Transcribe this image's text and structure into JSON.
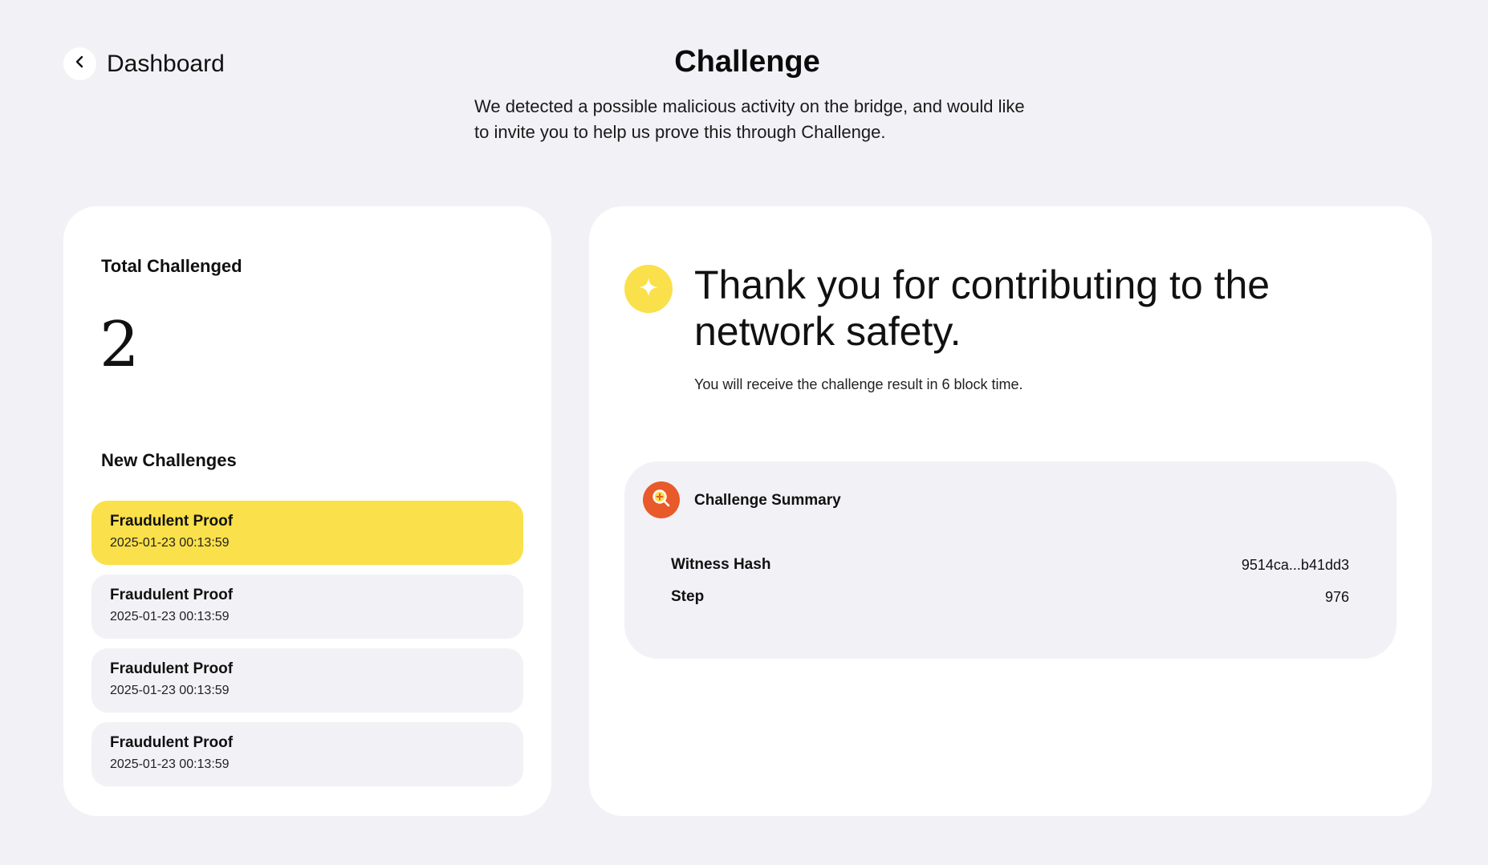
{
  "header": {
    "back_label": "Dashboard",
    "title": "Challenge",
    "subtitle": "We detected a possible malicious activity on the bridge, and would like to invite you to help us prove this through Challenge."
  },
  "left_panel": {
    "total_label": "Total Challenged",
    "total_value": "2",
    "new_label": "New Challenges",
    "challenges": [
      {
        "title": "Fraudulent Proof",
        "time": "2025-01-23 00:13:59",
        "selected": true
      },
      {
        "title": "Fraudulent Proof",
        "time": "2025-01-23 00:13:59",
        "selected": false
      },
      {
        "title": "Fraudulent Proof",
        "time": "2025-01-23 00:13:59",
        "selected": false
      },
      {
        "title": "Fraudulent Proof",
        "time": "2025-01-23 00:13:59",
        "selected": false
      }
    ]
  },
  "right_panel": {
    "icon": "sparkle-icon",
    "heading": "Thank you for contributing to the network safety.",
    "note": "You will receive the challenge result in 6 block time.",
    "summary": {
      "icon": "search-icon",
      "title": "Challenge Summary",
      "rows": [
        {
          "key": "Witness Hash",
          "value": "9514ca...b41dd3"
        },
        {
          "key": "Step",
          "value": "976"
        }
      ]
    }
  },
  "colors": {
    "background": "#f2f2f6",
    "card": "#ffffff",
    "accent_yellow": "#fae04a",
    "summary_icon": "#e85a2a"
  }
}
